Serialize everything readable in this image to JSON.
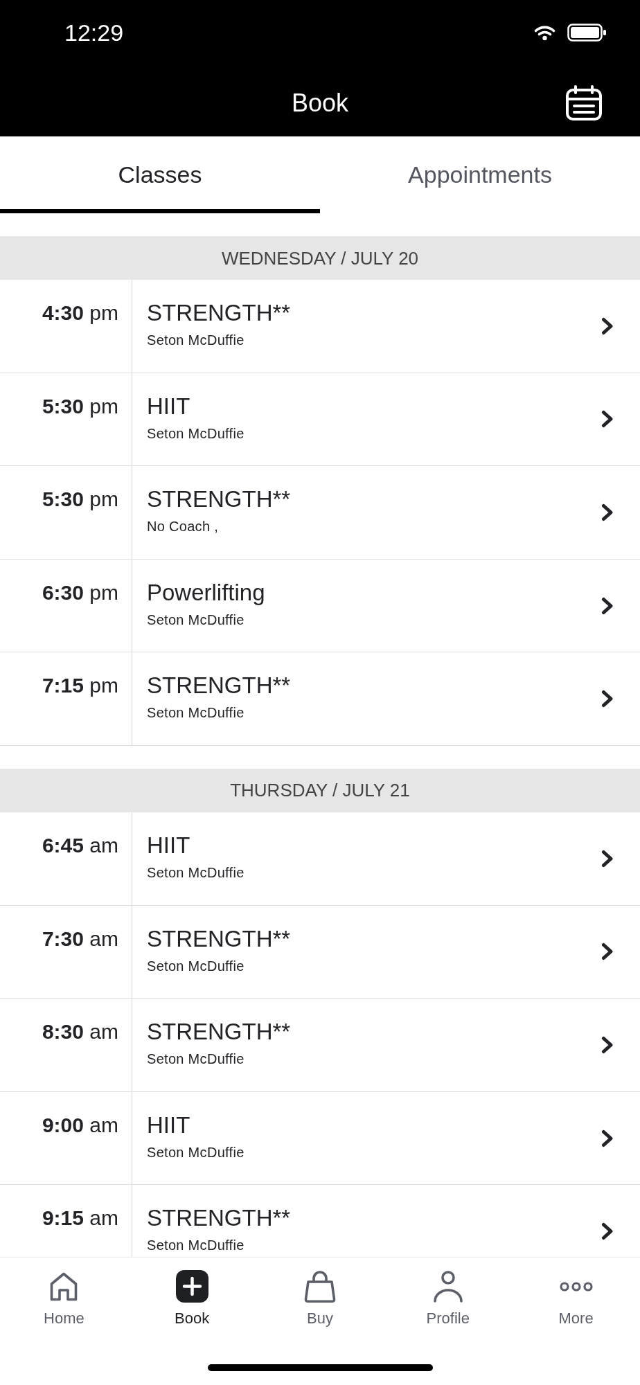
{
  "status_bar": {
    "time": "12:29"
  },
  "header": {
    "title": "Book"
  },
  "tabs": [
    {
      "label": "Classes",
      "selected": true
    },
    {
      "label": "Appointments",
      "selected": false
    }
  ],
  "schedule": [
    {
      "heading": "WEDNESDAY / JULY 20",
      "classes": [
        {
          "time": "**4:30** pm",
          "name": "STRENGTH**",
          "coach": "Seton McDuffie"
        },
        {
          "time": "**5:30** pm",
          "name": "HIIT",
          "coach": "Seton McDuffie"
        },
        {
          "time": "**5:30** pm",
          "name": "STRENGTH**",
          "coach": "No Coach ,"
        },
        {
          "time": "**6:30** pm",
          "name": "Powerlifting",
          "coach": "Seton McDuffie"
        },
        {
          "time": "**7:15** pm",
          "name": "STRENGTH**",
          "coach": "Seton McDuffie"
        }
      ]
    },
    {
      "heading": "THURSDAY / JULY 21",
      "classes": [
        {
          "time": "**6:45** am",
          "name": "HIIT",
          "coach": "Seton McDuffie"
        },
        {
          "time": "**7:30** am",
          "name": "STRENGTH**",
          "coach": "Seton McDuffie"
        },
        {
          "time": "**8:30** am",
          "name": "STRENGTH**",
          "coach": "Seton McDuffie"
        },
        {
          "time": "**9:00** am",
          "name": "HIIT",
          "coach": "Seton McDuffie"
        },
        {
          "time": "**9:15** am",
          "name": "STRENGTH**",
          "coach": "Seton McDuffie"
        }
      ]
    }
  ],
  "bottom_nav": [
    {
      "label": "Home",
      "kind": "home",
      "selected": false
    },
    {
      "label": "Book",
      "kind": "add",
      "selected": true
    },
    {
      "label": "Buy",
      "kind": "bag",
      "selected": false
    },
    {
      "label": "Profile",
      "kind": "person",
      "selected": false
    },
    {
      "label": "More",
      "kind": "more",
      "selected": false
    }
  ]
}
